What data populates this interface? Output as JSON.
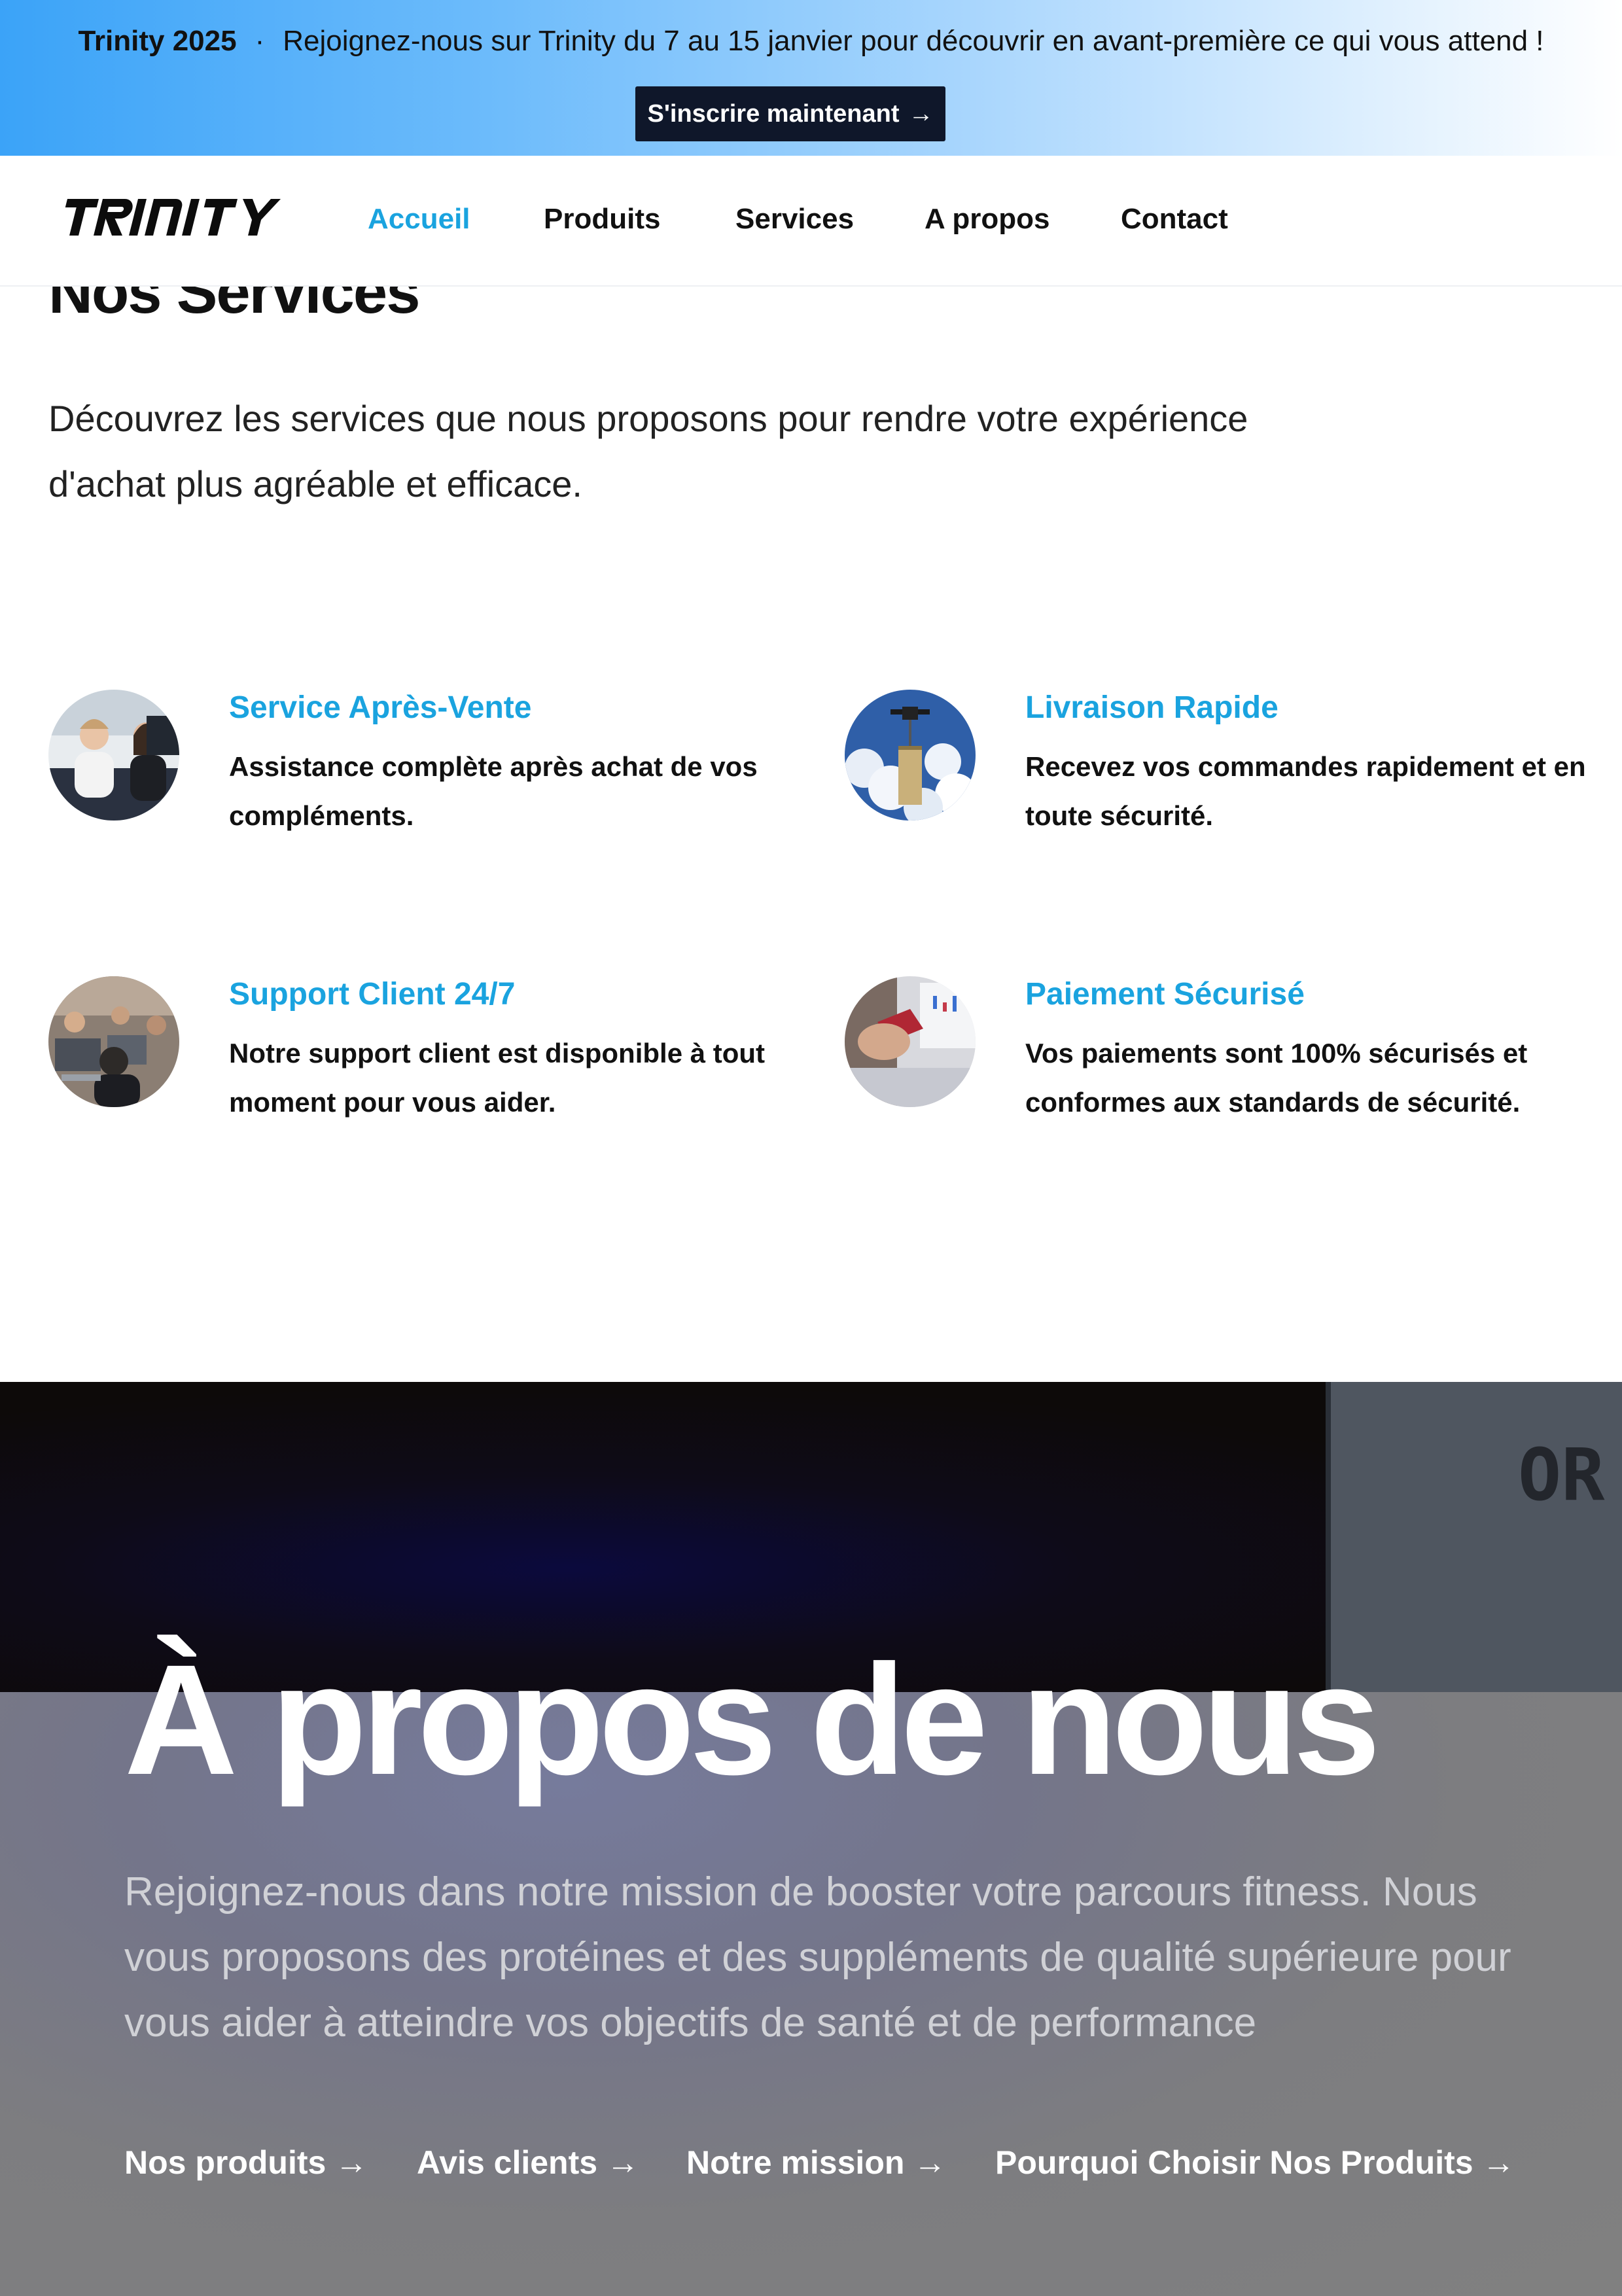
{
  "banner": {
    "event_name": "Trinity 2025",
    "separator": "·",
    "message": "Rejoignez-nous sur Trinity du 7 au 15 janvier pour découvrir en avant-première ce qui vous attend !",
    "cta_label": "S'inscrire maintenant",
    "cta_arrow": "→",
    "gradient_start": "#3ba3f8",
    "cta_bg": "#0f172a"
  },
  "nav": {
    "logo": "TRINITY",
    "items": [
      {
        "label": "Accueil",
        "active": true
      },
      {
        "label": "Produits",
        "active": false
      },
      {
        "label": "Services",
        "active": false
      },
      {
        "label": "A propos",
        "active": false
      },
      {
        "label": "Contact",
        "active": false
      }
    ],
    "active_color": "#1aa3df"
  },
  "services": {
    "title": "Nos Services",
    "intro": "Découvrez les services que nous proposons pour rendre votre expérience d'achat plus agréable et efficace.",
    "items": [
      {
        "title": "Service Après-Vente",
        "description": "Assistance complète après achat de vos compléments.",
        "image": "customer-support-team-photo"
      },
      {
        "title": "Livraison Rapide",
        "description": "Recevez vos commandes rapidement et en toute sécurité.",
        "image": "delivery-drone-photo"
      },
      {
        "title": "Support Client 24/7",
        "description": "Notre support client est disponible à tout moment pour vous aider.",
        "image": "office-team-laptops-photo"
      },
      {
        "title": "Paiement Sécurisé",
        "description": "Vos paiements sont 100% sécurisés et conformes aux standards de sécurité.",
        "image": "card-payment-photo"
      }
    ],
    "title_color": "#1aa3df"
  },
  "about": {
    "title": "À propos de nous",
    "text": "Rejoignez-nous dans notre mission de booster votre parcours fitness. Nous vous proposons des protéines et des suppléments de qualité supérieure pour vous aider à atteindre vos objectifs de santé et de performance",
    "sign_text": "OR",
    "links": [
      {
        "label": "Nos produits",
        "arrow": "→"
      },
      {
        "label": "Avis clients",
        "arrow": "→"
      },
      {
        "label": "Notre mission",
        "arrow": "→"
      },
      {
        "label": "Pourquoi Choisir Nos Produits",
        "arrow": "→"
      }
    ]
  }
}
